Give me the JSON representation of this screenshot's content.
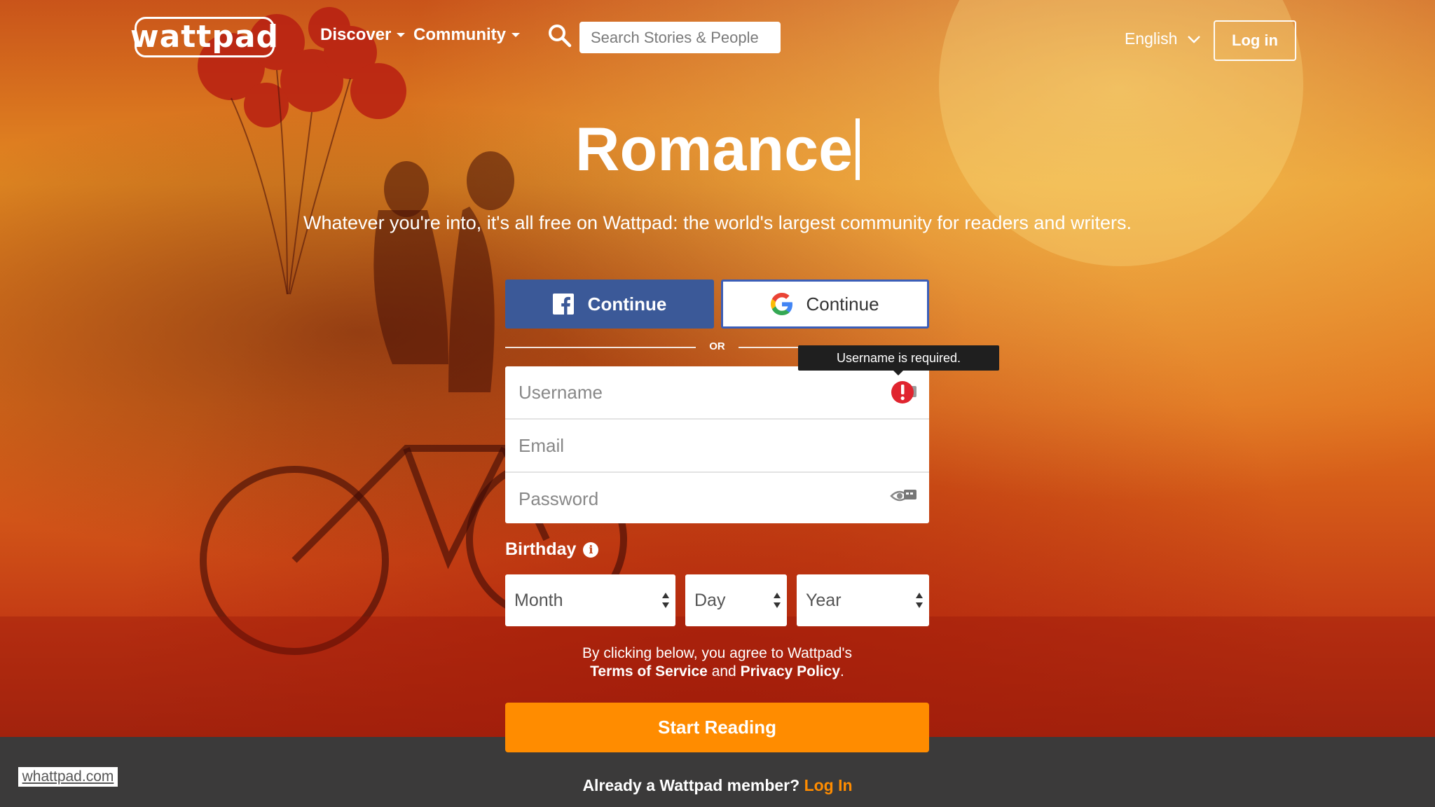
{
  "nav": {
    "logo_text": "wattpad",
    "discover": "Discover",
    "community": "Community",
    "search_placeholder": "Search Stories & People",
    "language": "English",
    "login": "Log in"
  },
  "hero": {
    "headline": "Romance",
    "tagline": "Whatever you're into, it's all free on Wattpad: the world's largest community for readers and writers."
  },
  "social": {
    "facebook_label": "Continue",
    "google_label": "Continue",
    "or_label": "OR"
  },
  "form": {
    "username_placeholder": "Username",
    "email_placeholder": "Email",
    "password_placeholder": "Password",
    "username_error": "Username is required.",
    "birthday_label": "Birthday",
    "month_label": "Month",
    "day_label": "Day",
    "year_label": "Year"
  },
  "legal": {
    "line1": "By clicking below, you agree to Wattpad's",
    "terms": "Terms of Service",
    "and": "and",
    "privacy": "Privacy Policy",
    "period": "."
  },
  "cta": {
    "start_reading": "Start Reading"
  },
  "footer": {
    "member_text": "Already a Wattpad member?",
    "member_login": "Log In",
    "site_url": "whattpad.com"
  },
  "colors": {
    "facebook": "#3b5998",
    "google_border": "#3b5eb8",
    "cta": "#ff8c00",
    "error": "#e0242f",
    "footer_bg": "#3b3a3a"
  }
}
